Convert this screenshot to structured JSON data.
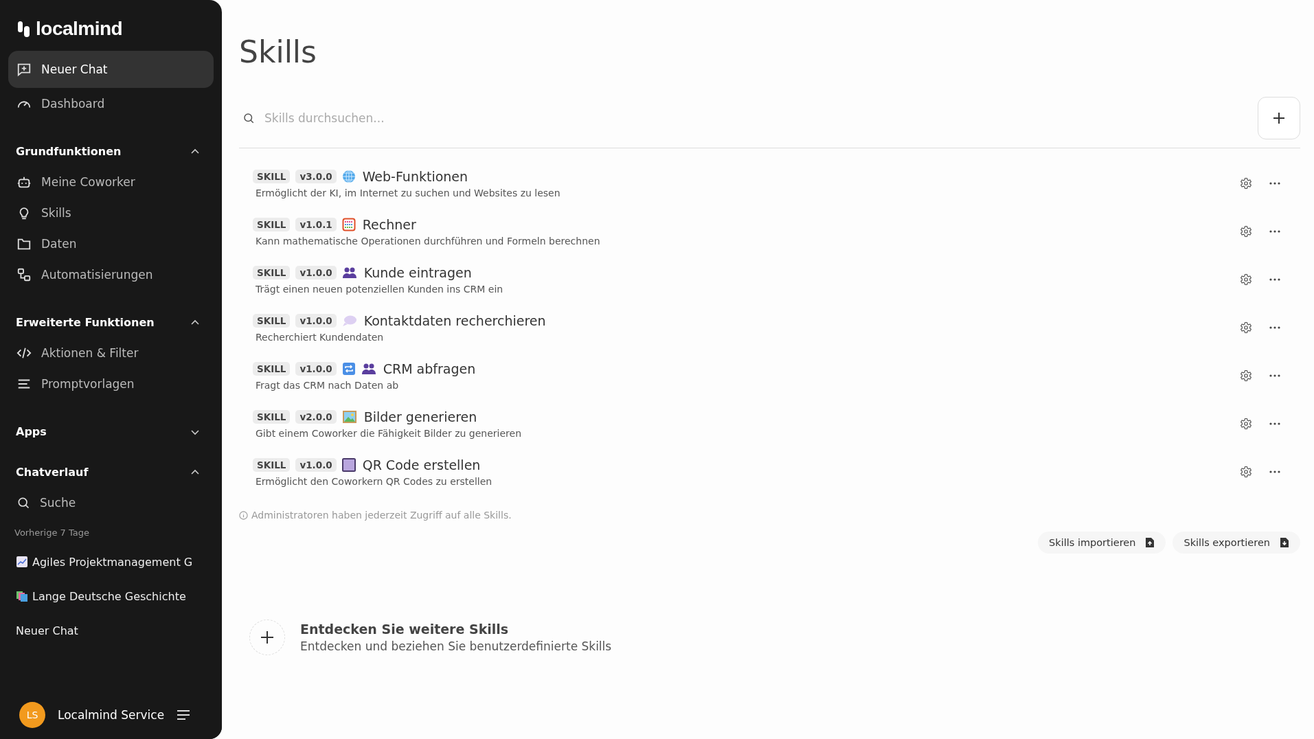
{
  "sidebar": {
    "logo": "localmind",
    "new_chat": {
      "label": "Neuer Chat",
      "selected": true
    },
    "dashboard": {
      "label": "Dashboard"
    },
    "sections": [
      {
        "title": "Grundfunktionen",
        "expanded": true,
        "items": [
          {
            "label": "Meine Coworker",
            "kind": "robot"
          },
          {
            "label": "Skills",
            "kind": "bulb"
          },
          {
            "label": "Daten",
            "kind": "folder"
          },
          {
            "label": "Automatisierungen",
            "kind": "flow"
          }
        ]
      },
      {
        "title": "Erweiterte Funktionen",
        "expanded": true,
        "items": [
          {
            "label": "Aktionen & Filter",
            "kind": "code"
          },
          {
            "label": "Promptvorlagen",
            "kind": "lines"
          }
        ]
      },
      {
        "title": "Apps",
        "expanded": false
      },
      {
        "title": "Chatverlauf",
        "expanded": true,
        "items": [
          {
            "label": "Suche",
            "kind": "search"
          }
        ]
      }
    ],
    "history_group": "Vorherige 7 Tage",
    "chats": [
      {
        "label": "Agiles Projektmanagement G",
        "kind": "chart"
      },
      {
        "label": "Lange Deutsche Geschichte",
        "kind": "books"
      },
      {
        "label": "Neuer Chat",
        "kind": "plain"
      }
    ],
    "user": {
      "initials": "LS",
      "name": "Localmind Service"
    }
  },
  "page": {
    "title": "Skills",
    "search": {
      "placeholder": "Skills durchsuchen..."
    },
    "skills": [
      {
        "tag": "SKILL",
        "version": "v3.0.0",
        "kind": "globe",
        "name": "Web-Funktionen",
        "description": "Ermöglicht der KI, im Internet zu suchen und Websites zu lesen"
      },
      {
        "tag": "SKILL",
        "version": "v1.0.1",
        "kind": "abacus",
        "name": "Rechner",
        "description": "Kann mathematische Operationen durchführen und Formeln berechnen"
      },
      {
        "tag": "SKILL",
        "version": "v1.0.0",
        "kind": "people",
        "name": "Kunde eintragen",
        "description": "Trägt einen neuen potenziellen Kunden ins CRM ein"
      },
      {
        "tag": "SKILL",
        "version": "v1.0.0",
        "kind": "bubble",
        "name": "Kontaktdaten recherchieren",
        "description": "Recherchiert Kundendaten"
      },
      {
        "tag": "SKILL",
        "version": "v1.0.0",
        "kind": "sync",
        "name": "CRM abfragen",
        "description": "Fragt das CRM nach Daten ab"
      },
      {
        "tag": "SKILL",
        "version": "v2.0.0",
        "kind": "picture",
        "name": "Bilder generieren",
        "description": "Gibt einem Coworker die Fähigkeit Bilder zu generieren"
      },
      {
        "tag": "SKILL",
        "version": "v1.0.0",
        "kind": "square",
        "name": "QR Code erstellen",
        "description": "Ermöglicht den Coworkern QR Codes zu erstellen"
      }
    ],
    "info": "Administratoren haben jederzeit Zugriff auf alle Skills.",
    "import_button": "Skills importieren",
    "export_button": "Skills exportieren",
    "discover": {
      "title": "Entdecken Sie weitere Skills",
      "subtitle": "Entdecken und beziehen Sie benutzerdefinierte Skills"
    }
  }
}
